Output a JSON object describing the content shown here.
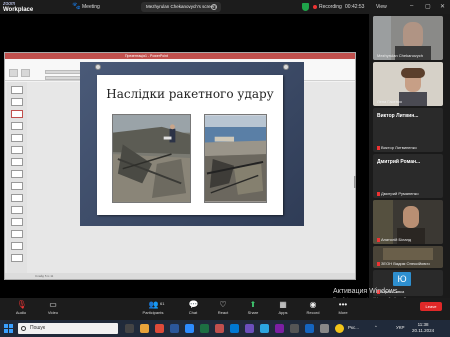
{
  "topbar": {
    "app_brand_top": "zoom",
    "app_brand_bottom": "Workplace",
    "meeting_label": "Meeting",
    "share_banner": "Mezhyrulan Chekanovych's screen",
    "recording_label": "Recording",
    "timer": "00:42:53",
    "view_label": "View"
  },
  "ppt": {
    "title_bar": "Презентація1 - PowerPoint",
    "slide_title": "Наслідки ракетного удару",
    "status_text": "Слайд 5 із 11"
  },
  "gallery": {
    "participants": [
      {
        "name": "Mezhyrulan Chekanovych",
        "style": "video-grey"
      },
      {
        "name": "Лена Гасенко",
        "style": "video-face"
      },
      {
        "name": "Виктор Литвиненко",
        "bigname": "Виктор  Литвин...",
        "style": "name-tile",
        "muted": true
      },
      {
        "name": "Дмитрий Руманенко",
        "bigname": "Дмитрий  Роман...",
        "style": "name-tile",
        "muted": true
      },
      {
        "name": "Анатолій Біланд",
        "style": "video-face",
        "muted": true
      },
      {
        "name": "ЗЕОН Вадим Олексійович",
        "style": "video-room",
        "muted": true
      },
      {
        "name": "Юрий Савка",
        "badge": "Ю",
        "style": "badge",
        "muted": true
      },
      {
        "name": "Артем Жолданко",
        "style": "video-face",
        "muted": true
      }
    ]
  },
  "toolbar": {
    "audio": "Audio",
    "video": "Video",
    "participants": "Participants",
    "participants_count": "61",
    "chat": "Chat",
    "react": "React",
    "share": "Share",
    "apps": "Apps",
    "record": "Record",
    "more": "More",
    "leave": "Leave"
  },
  "activation": {
    "title": "Активация Windows",
    "line1": "Перейдіть до розділу \"Настройки\", щоб",
    "line2": "активувати Windows."
  },
  "taskbar": {
    "search_placeholder": "Пошук",
    "tray_text": "Ркс...",
    "lang": "УКР",
    "time": "11:38",
    "date": "20.11.2024"
  },
  "colors": {
    "ppt_accent": "#c0504d",
    "zoom_leave": "#e02828",
    "record_dot": "#e33333",
    "shield": "#1fa34a"
  }
}
